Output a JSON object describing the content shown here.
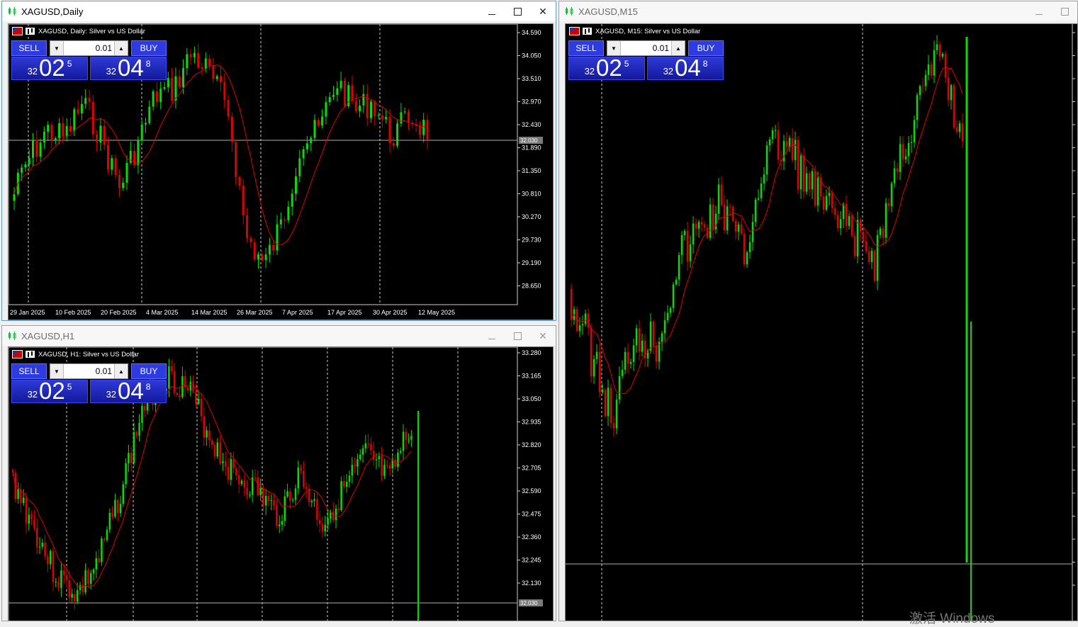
{
  "windows": {
    "daily": {
      "title": "XAGUSD,Daily",
      "chart_label": "XAGUSD, Daily:  Silver vs US Dollar",
      "y_ticks": [
        "34.590",
        "34.050",
        "33.510",
        "32.970",
        "32.430",
        "31.890",
        "31.350",
        "30.810",
        "30.270",
        "29.730",
        "29.190",
        "28.650"
      ],
      "x_ticks": [
        "29 Jan 2025",
        "10 Feb 2025",
        "20 Feb 2025",
        "4 Mar 2025",
        "14 Mar 2025",
        "26 Mar 2025",
        "7 Apr 2025",
        "17 Apr 2025",
        "30 Apr 2025",
        "12 May 2025"
      ],
      "price_tag": "32.030"
    },
    "h1": {
      "title": "XAGUSD,H1",
      "chart_label": "XAGUSD, H1:  Silver vs US Dollar",
      "y_ticks": [
        "33.280",
        "33.165",
        "33.050",
        "32.935",
        "32.820",
        "32.705",
        "32.590",
        "32.475",
        "32.360",
        "32.245",
        "32.130"
      ],
      "price_tag": "32.030"
    },
    "m15": {
      "title": "XAGUSD,M15",
      "chart_label": "XAGUSD, M15:  Silver vs US Dollar"
    }
  },
  "trade_panel": {
    "sell_label": "SELL",
    "buy_label": "BUY",
    "lot": "0.01",
    "sell_price": {
      "small": "32",
      "big": "02",
      "sup": "5"
    },
    "buy_price": {
      "small": "32",
      "big": "04",
      "sup": "8"
    }
  },
  "watermark": "激活 Windows",
  "colors": {
    "chart_bg": "#000000",
    "bull": "#00e000",
    "bear": "#e00000",
    "ma_line": "#e00000",
    "panel_blue": "#2d3be0",
    "active_border": "#5f9bd5"
  }
}
